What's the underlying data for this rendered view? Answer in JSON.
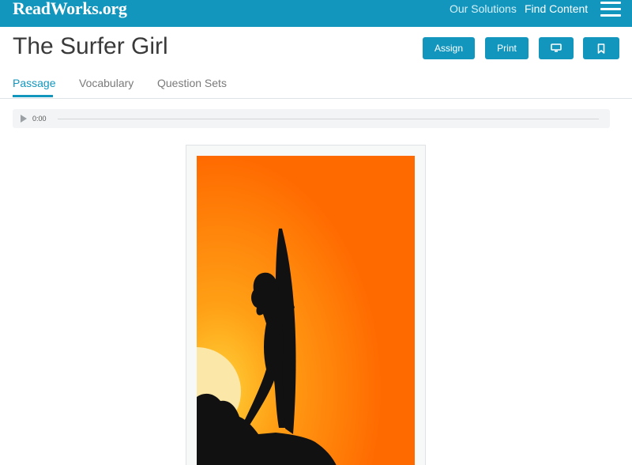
{
  "header": {
    "logo": "ReadWorks.org",
    "nav": {
      "our_solutions": "Our Solutions",
      "find_content": "Find Content"
    }
  },
  "passage": {
    "title": "The Surfer Girl",
    "actions": {
      "assign": "Assign",
      "print": "Print"
    }
  },
  "tabs": [
    {
      "label": "Passage",
      "active": true
    },
    {
      "label": "Vocabulary",
      "active": false
    },
    {
      "label": "Question Sets",
      "active": false
    }
  ],
  "audio": {
    "time": "0:00",
    "progress": 0
  },
  "colors": {
    "brand": "#1296be",
    "image_background": "#ff6a00",
    "sun": "#fbe7a8"
  },
  "icons": [
    "hamburger-menu-icon",
    "present-screen-icon",
    "bookmark-icon",
    "play-icon"
  ]
}
